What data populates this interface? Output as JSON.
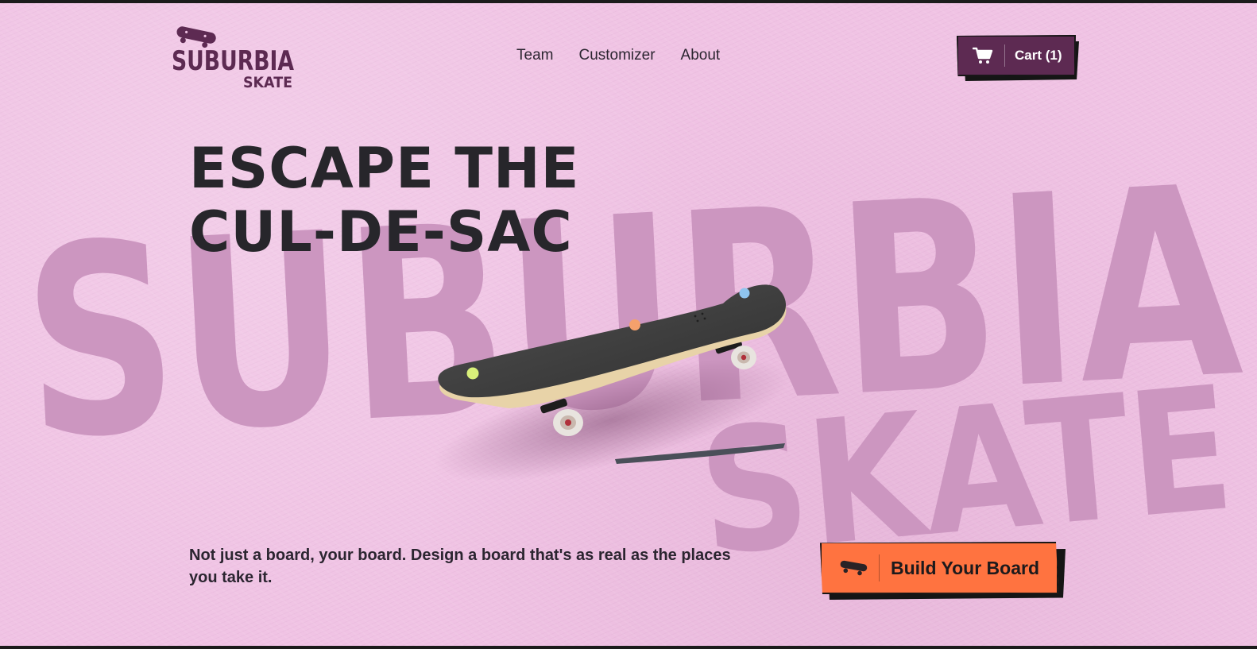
{
  "brand": {
    "logo_line1": "SUBURBIA",
    "logo_line2": "SKATE",
    "background_word_line1": "SUBURBIA",
    "background_word_line2": "SKATE"
  },
  "nav": {
    "items": [
      {
        "label": "Team"
      },
      {
        "label": "Customizer"
      },
      {
        "label": "About"
      }
    ]
  },
  "cart": {
    "label": "Cart (1)",
    "icon": "shopping-cart-icon",
    "count": 1
  },
  "hero": {
    "headline_line1": "ESCAPE THE",
    "headline_line2": "CUL-DE-SAC",
    "tagline": "Not just a board, your board. Design a board that's as real as the places you take it.",
    "cta_label": "Build Your Board",
    "cta_icon": "skateboard-icon"
  },
  "colors": {
    "background": "#f0c3e4",
    "background_word": "#cc96c0",
    "brand_plum": "#5d2a52",
    "cta_orange": "#ff7340",
    "text_dark": "#27262b",
    "board_deck": "#3a3a3a",
    "bolt_green": "#d9f07a",
    "bolt_orange": "#f4a06c",
    "bolt_blue": "#8fc4ee"
  }
}
